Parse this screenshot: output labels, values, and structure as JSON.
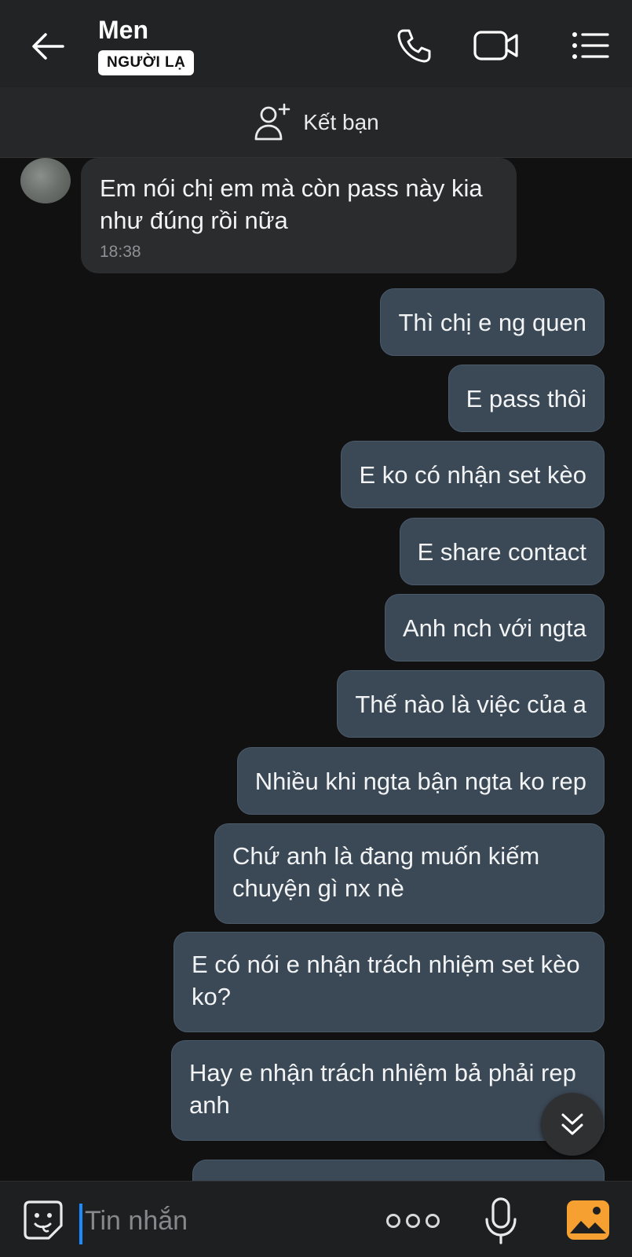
{
  "header": {
    "title": "Men",
    "badge": "NGƯỜI LẠ"
  },
  "friend_bar": {
    "label": "Kết bạn"
  },
  "messages": {
    "incoming": {
      "text": "Em nói chị em mà còn pass này kia như đúng rồi nữa",
      "time": "18:38"
    },
    "outgoing": [
      "Thì chị e ng quen",
      "E pass thôi",
      "E ko có nhận set kèo",
      "E share contact",
      "Anh nch với ngta",
      "Thế nào là việc của a",
      "Nhiều khi ngta bận ngta ko rep",
      "Chứ anh là đang muốn kiếm chuyện gì nx nè",
      "E có nói e nhận trách nhiệm set kèo ko?",
      "Hay e nhận trách nhiệm bả phải rep anh"
    ]
  },
  "input": {
    "placeholder": "Tin nhắn"
  },
  "colors": {
    "background": "#111111",
    "header": "#222324",
    "outgoing_bubble": "#3b4855",
    "incoming_bubble": "#2b2c2e",
    "cursor": "#1a8cff",
    "gallery_accent": "#f5a030"
  },
  "icons": {
    "back": "arrow-left-icon",
    "call": "phone-icon",
    "video": "video-camera-icon",
    "menu": "list-menu-icon",
    "add_friend": "add-user-icon",
    "scroll": "double-chevron-down-icon",
    "emoji": "sticker-icon",
    "more": "more-dots-icon",
    "mic": "microphone-icon",
    "gallery": "image-icon"
  }
}
